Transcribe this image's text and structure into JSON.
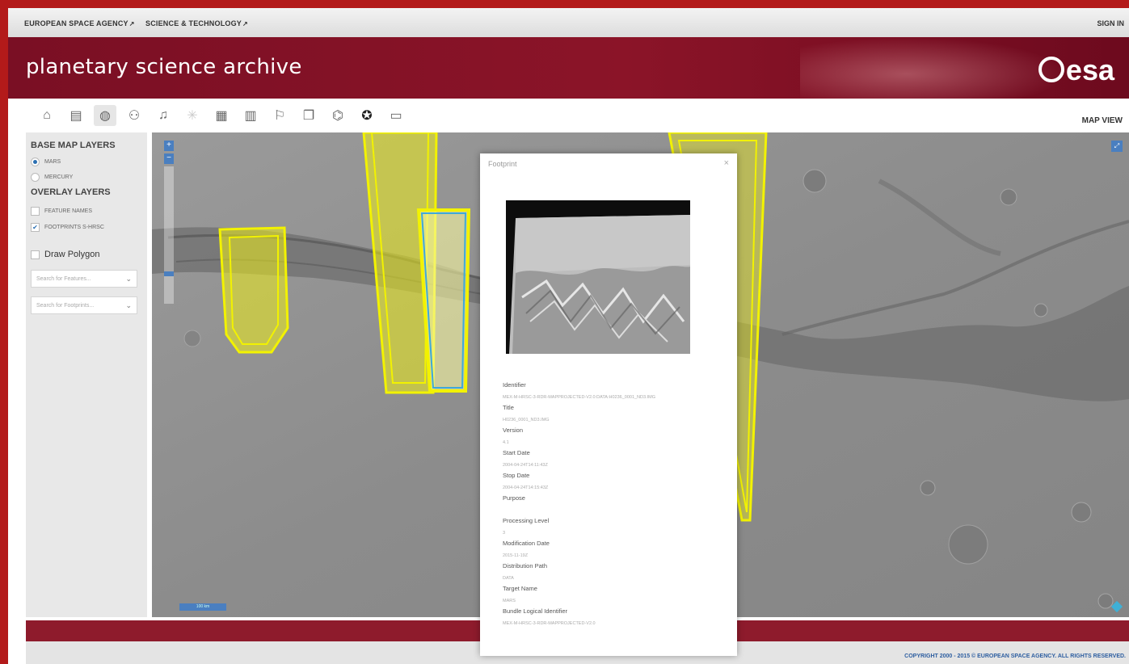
{
  "topbar": {
    "links": [
      "EUROPEAN SPACE AGENCY",
      "SCIENCE & TECHNOLOGY"
    ],
    "sign_in": "SIGN IN"
  },
  "banner": {
    "title": "planetary science archive",
    "logo_text": "esa"
  },
  "toolbar": {
    "view_label": "MAP VIEW",
    "tools": [
      "home-icon",
      "table-icon",
      "globe-icon",
      "binoculars-icon",
      "music-note-icon",
      "asterisk-icon",
      "document-icon",
      "books-icon",
      "signpost-icon",
      "copy-icon",
      "telescope-icon",
      "lifebuoy-icon",
      "window-icon"
    ],
    "active_tool_index": 2
  },
  "left_panel": {
    "base_map_heading": "BASE MAP LAYERS",
    "base_layers": [
      {
        "label": "MARS",
        "selected": true
      },
      {
        "label": "MERCURY",
        "selected": false
      }
    ],
    "overlay_heading": "OVERLAY LAYERS",
    "overlay_layers": [
      {
        "label": "FEATURE NAMES",
        "checked": false
      },
      {
        "label": "FOOTPRINTS S-HRSC",
        "checked": true
      }
    ],
    "draw_polygon": "Draw Polygon",
    "search_features_placeholder": "Search for Features...",
    "search_footprints_placeholder": "Search for Footprints..."
  },
  "map": {
    "zoom_in": "+",
    "zoom_out": "−",
    "zoom_level": 0.2,
    "scale_label": "100 km"
  },
  "popup": {
    "title": "Footprint",
    "close": "×",
    "fields": [
      {
        "label": "Identifier",
        "value": "MEX-M-HRSC-3-RDR-MAPPROJECTED-V2.0:DATA:H0236_0001_ND3.IMG"
      },
      {
        "label": "Title",
        "value": "H0236_0001_ND3.IMG"
      },
      {
        "label": "Version",
        "value": "4.1"
      },
      {
        "label": "Start Date",
        "value": "2004-04-24T14:11:43Z"
      },
      {
        "label": "Stop Date",
        "value": "2004-04-24T14:15:43Z"
      },
      {
        "label": "Purpose",
        "value": ""
      },
      {
        "label": "Processing Level",
        "value": "3"
      },
      {
        "label": "Modification Date",
        "value": "2015-11-19Z"
      },
      {
        "label": "Distribution Path",
        "value": "DATA"
      },
      {
        "label": "Target Name",
        "value": "MARS"
      },
      {
        "label": "Bundle Logical Identifier",
        "value": "MEX-M-HRSC-3-RDR-MAPPROJECTED-V2.0"
      }
    ]
  },
  "footer": {
    "copyright": "COPYRIGHT 2000 - 2015 © EUROPEAN SPACE AGENCY. ALL RIGHTS RESERVED."
  },
  "colors": {
    "brand_red": "#8b1428",
    "footprint_yellow": "#f2f200",
    "selected_outline": "#3fa9d8",
    "accent_blue": "#4a7fc0"
  }
}
